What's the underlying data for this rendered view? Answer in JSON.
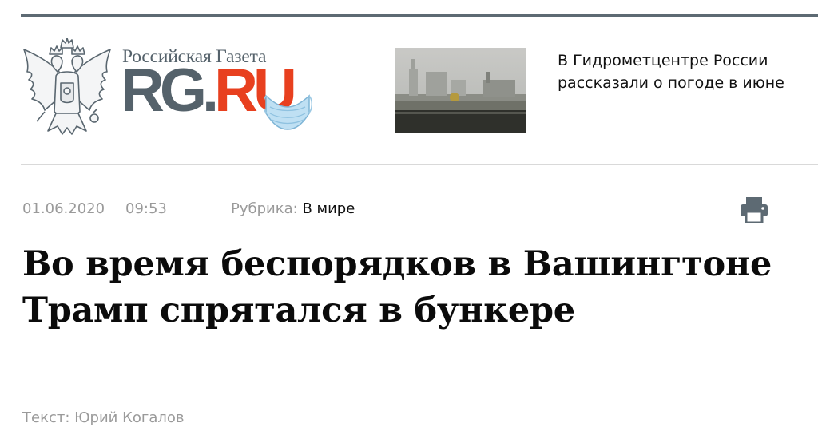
{
  "site": {
    "name": "Российская Газета",
    "logo_rg": "RG",
    "logo_dot": ".",
    "logo_ru": "RU",
    "colors": {
      "brand_gray": "#55626b",
      "brand_red": "#e8401f",
      "mask_blue": "#bfe0f3"
    }
  },
  "teaser": {
    "text": "В Гидрометцентре России рассказали о погоде в июне",
    "image_icon": "moscow-skyline-photo"
  },
  "article": {
    "date": "01.06.2020",
    "time": "09:53",
    "rubric_label": "Рубрика:",
    "rubric_value": "В мире",
    "title": "Во время беспорядков в Вашингтоне Трамп спрятался в бункере",
    "author": "Текст: Юрий Когалов"
  },
  "icons": {
    "print": "printer-icon",
    "emblem": "coat-of-arms-icon",
    "mask": "face-mask-icon"
  }
}
